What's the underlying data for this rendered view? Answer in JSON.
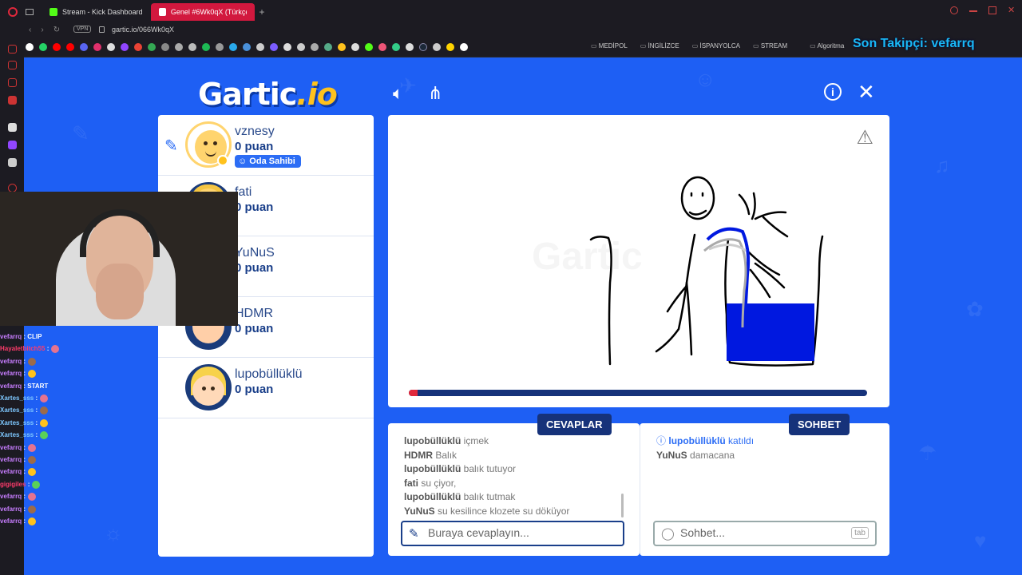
{
  "browser": {
    "tabs": [
      {
        "label": "Stream - Kick Dashboard",
        "color": "#53fc18"
      },
      {
        "label": "Genel #6Wk0qX (Türkçe)",
        "color": "#2c6df5"
      }
    ],
    "vpn": "VPN",
    "url": "gartic.io/066Wk0qX",
    "bookmark_folders": [
      "MEDİPOL",
      "İNGİLİZCE",
      "İSPANYOLCA",
      "STREAM",
      "Algoritma"
    ]
  },
  "overlay": {
    "last_follower": "Son Takipçi: vefarrq"
  },
  "game": {
    "logo_main": "Gartic",
    "logo_suffix": ".io",
    "accent": "#1e5ff4",
    "players": [
      {
        "name": "vznesy",
        "score": "0 puan",
        "badge": "Oda Sahibi",
        "drawing": true
      },
      {
        "name": "fati",
        "score": "0 puan"
      },
      {
        "name": "YuNuS",
        "score": "0 puan"
      },
      {
        "name": "HDMR",
        "score": "0 puan"
      },
      {
        "name": "lupobüllüklü",
        "score": "0 puan"
      }
    ],
    "timer_progress": 0.02,
    "answers": {
      "tab_label": "CEVAPLAR",
      "messages": [
        {
          "who": "lupobüllüklü",
          "text": "içmek"
        },
        {
          "who": "HDMR",
          "text": "Balık"
        },
        {
          "who": "lupobüllüklü",
          "text": "balık tutuyor"
        },
        {
          "who": "fati",
          "text": "su çiyor,"
        },
        {
          "who": "lupobüllüklü",
          "text": "balık tutmak"
        },
        {
          "who": "YuNuS",
          "text": "su kesilince klozete su döküyor"
        }
      ],
      "placeholder": "Buraya cevaplayın..."
    },
    "chat": {
      "tab_label": "SOHBET",
      "messages": [
        {
          "who": "lupobüllüklü",
          "text": "katıldı",
          "system": true
        },
        {
          "who": "YuNuS",
          "text": "damacana"
        }
      ],
      "placeholder": "Sohbet...",
      "tab_key": "tab"
    }
  },
  "stream_chat": [
    {
      "user": "vefarrq",
      "msg": ": CLIP"
    },
    {
      "user": "Hayaletbitch55",
      "msg": ":"
    },
    {
      "user": "vefarrq",
      "msg": ":"
    },
    {
      "user": "vefarrq",
      "msg": ":"
    },
    {
      "user": "vefarrq",
      "msg": ": START"
    },
    {
      "user": "Xartes_sss",
      "msg": ":"
    },
    {
      "user": "Xartes_sss",
      "msg": ":"
    },
    {
      "user": "Xartes_sss",
      "msg": ":"
    },
    {
      "user": "Xartes_sss",
      "msg": ":"
    },
    {
      "user": "vefarrq",
      "msg": ":"
    },
    {
      "user": "vefarrq",
      "msg": ":"
    },
    {
      "user": "vefarrq",
      "msg": ":"
    },
    {
      "user": "gigigiles",
      "msg": ":"
    },
    {
      "user": "vefarrq",
      "msg": ":"
    },
    {
      "user": "vefarrq",
      "msg": ":"
    },
    {
      "user": "vefarrq",
      "msg": ":"
    }
  ]
}
